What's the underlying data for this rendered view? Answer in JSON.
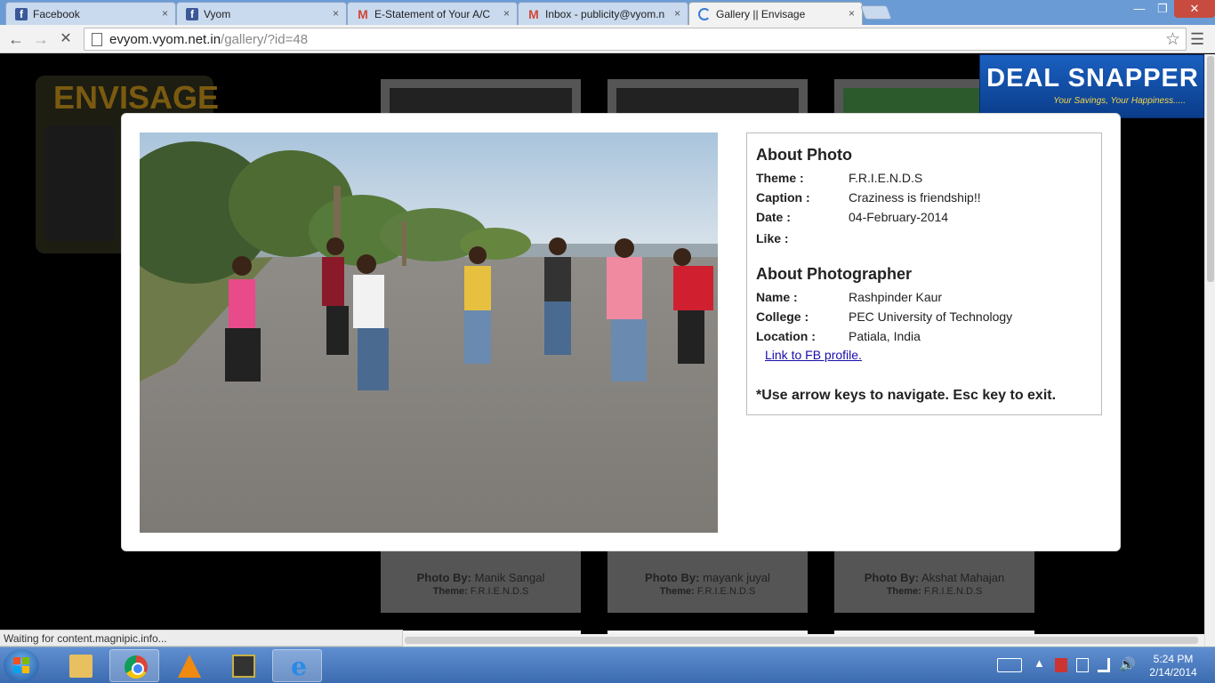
{
  "browser": {
    "tabs": [
      {
        "label": "Facebook",
        "icon": "facebook-icon"
      },
      {
        "label": "Vyom",
        "icon": "facebook-icon"
      },
      {
        "label": "E-Statement of Your A/C",
        "icon": "gmail-icon"
      },
      {
        "label": "Inbox - publicity@vyom.n",
        "icon": "gmail-icon"
      },
      {
        "label": "Gallery || Envisage",
        "icon": "loading-icon",
        "active": true
      }
    ],
    "close_glyph": "×",
    "url_host": "evyom.vyom.net.in",
    "url_path": "/gallery/?id=48",
    "status_text": "Waiting for content.magnipic.info..."
  },
  "page": {
    "logo_text": "ENVISAGE",
    "ad": {
      "title": "DEAL SNAPPER",
      "tagline": "Your Savings, Your Happiness....."
    },
    "cards": [
      {
        "photo_by_label": "Photo By:",
        "photographer": "Manik Sangal",
        "theme_label": "Theme:",
        "theme": "F.R.I.E.N.D.S"
      },
      {
        "photo_by_label": "Photo By:",
        "photographer": "mayank juyal",
        "theme_label": "Theme:",
        "theme": "F.R.I.E.N.D.S"
      },
      {
        "photo_by_label": "Photo By:",
        "photographer": "Akshat Mahajan",
        "theme_label": "Theme:",
        "theme": "F.R.I.E.N.D.S"
      }
    ]
  },
  "lightbox": {
    "about_photo_heading": "About Photo",
    "photo_fields": [
      {
        "label": "Theme :",
        "value": "F.R.I.E.N.D.S"
      },
      {
        "label": "Caption :",
        "value": "Craziness is friendship!!"
      },
      {
        "label": "Date :",
        "value": "04-February-2014"
      },
      {
        "label": "Like :",
        "value": ""
      }
    ],
    "about_photographer_heading": "About Photographer",
    "photographer_fields": [
      {
        "label": "Name :",
        "value": "Rashpinder Kaur"
      },
      {
        "label": "College :",
        "value": "PEC University of Technology"
      },
      {
        "label": "Location :",
        "value": "Patiala, India"
      }
    ],
    "fb_link_text": "Link to FB profile.",
    "hint": "*Use arrow keys to navigate. Esc key to exit."
  },
  "taskbar": {
    "pinned": [
      "windows-explorer-icon",
      "chrome-icon",
      "vlc-icon",
      "media-player-icon",
      "internet-explorer-icon"
    ],
    "clock_time": "5:24 PM",
    "clock_date": "2/14/2014"
  },
  "colors": {
    "accent": "#1a60c0",
    "link": "#1a0dab",
    "background": "#000000"
  }
}
